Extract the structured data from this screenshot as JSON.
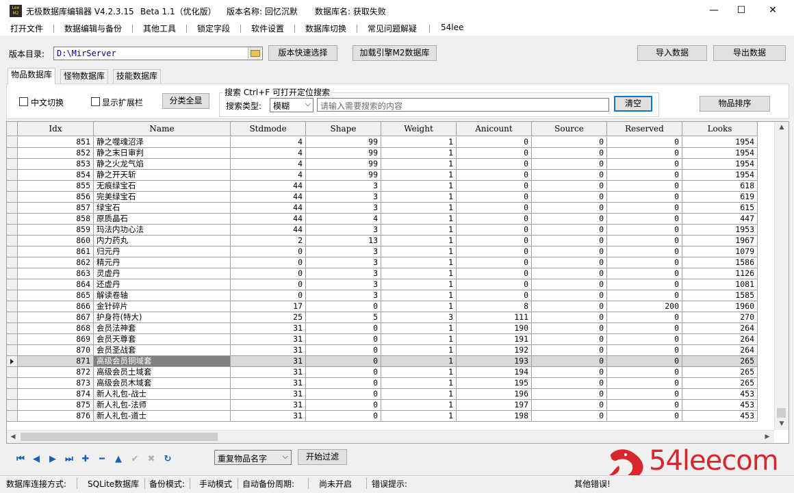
{
  "window": {
    "app_name": "无极数据库编辑器 V4.2.3.15",
    "build": "Beta 1.1（优化版）",
    "version_label": "版本名称: 回忆沉默",
    "db_label": "数据库名: 获取失败",
    "icon_text": "Lee M2",
    "minimize": "—",
    "maximize": "☐",
    "close": "✕"
  },
  "menu": [
    "打开文件",
    "数据编辑与备份",
    "其他工具",
    "锁定字段",
    "软件设置",
    "数据库切换",
    "常见问题解疑",
    "54lee"
  ],
  "toolbar": {
    "dir_label": "版本目录:",
    "dir_value": "D:\\MirServer",
    "quick_select": "版本快速选择",
    "load_engine": "加载引擎M2数据库",
    "import": "导入数据",
    "export": "导出数据"
  },
  "tabs": [
    "物品数据库",
    "怪物数据库",
    "技能数据库"
  ],
  "filters": {
    "chinese_toggle": "中文切换",
    "show_extended": "显示扩展栏",
    "show_all": "分类全显",
    "search_group_title": "搜索   Ctrl+F 可打开定位搜索",
    "search_type_label": "搜索类型:",
    "search_type_value": "模糊",
    "search_placeholder": "请输入需要搜索的内容",
    "clear": "清空",
    "sort": "物品排序"
  },
  "table": {
    "columns": [
      "Idx",
      "Name",
      "Stdmode",
      "Shape",
      "Weight",
      "Anicount",
      "Source",
      "Reserved",
      "Looks"
    ],
    "rows": [
      [
        "851",
        "静之噬魂沼泽",
        "4",
        "99",
        "1",
        "0",
        "0",
        "0",
        "1954"
      ],
      [
        "852",
        "静之末日审判",
        "4",
        "99",
        "1",
        "0",
        "0",
        "0",
        "1954"
      ],
      [
        "853",
        "静之火龙气焰",
        "4",
        "99",
        "1",
        "0",
        "0",
        "0",
        "1954"
      ],
      [
        "854",
        "静之开天斩",
        "4",
        "99",
        "1",
        "0",
        "0",
        "0",
        "1954"
      ],
      [
        "855",
        "无痕绿宝石",
        "44",
        "3",
        "1",
        "0",
        "0",
        "0",
        "618"
      ],
      [
        "856",
        "完美绿宝石",
        "44",
        "3",
        "1",
        "0",
        "0",
        "0",
        "619"
      ],
      [
        "857",
        "绿宝石",
        "44",
        "3",
        "1",
        "0",
        "0",
        "0",
        "615"
      ],
      [
        "858",
        "原质晶石",
        "44",
        "4",
        "1",
        "0",
        "0",
        "0",
        "447"
      ],
      [
        "859",
        "玛法内功心法",
        "44",
        "3",
        "1",
        "0",
        "0",
        "0",
        "1953"
      ],
      [
        "860",
        "内力药丸",
        "2",
        "13",
        "1",
        "0",
        "0",
        "0",
        "1967"
      ],
      [
        "861",
        "归元丹",
        "0",
        "3",
        "1",
        "0",
        "0",
        "0",
        "1079"
      ],
      [
        "862",
        "精元丹",
        "0",
        "3",
        "1",
        "0",
        "0",
        "0",
        "1586"
      ],
      [
        "863",
        "灵虚丹",
        "0",
        "3",
        "1",
        "0",
        "0",
        "0",
        "1126"
      ],
      [
        "864",
        "还虚丹",
        "0",
        "3",
        "1",
        "0",
        "0",
        "0",
        "1081"
      ],
      [
        "865",
        "解读卷轴",
        "0",
        "3",
        "1",
        "0",
        "0",
        "0",
        "1585"
      ],
      [
        "866",
        "金针碎片",
        "17",
        "0",
        "1",
        "8",
        "0",
        "200",
        "1960"
      ],
      [
        "867",
        "护身符(特大)",
        "25",
        "5",
        "3",
        "111",
        "0",
        "0",
        "270"
      ],
      [
        "868",
        "会员法神套",
        "31",
        "0",
        "1",
        "190",
        "0",
        "0",
        "264"
      ],
      [
        "869",
        "会员天尊套",
        "31",
        "0",
        "1",
        "191",
        "0",
        "0",
        "264"
      ],
      [
        "870",
        "会员圣战套",
        "31",
        "0",
        "1",
        "192",
        "0",
        "0",
        "264"
      ],
      [
        "871",
        "高级会员铜域套",
        "31",
        "0",
        "1",
        "193",
        "0",
        "0",
        "265"
      ],
      [
        "872",
        "高级会员土域套",
        "31",
        "0",
        "1",
        "194",
        "0",
        "0",
        "265"
      ],
      [
        "873",
        "高级会员木域套",
        "31",
        "0",
        "1",
        "195",
        "0",
        "0",
        "265"
      ],
      [
        "874",
        "新人礼包-战士",
        "31",
        "0",
        "1",
        "196",
        "0",
        "0",
        "453"
      ],
      [
        "875",
        "新人礼包-法师",
        "31",
        "0",
        "1",
        "197",
        "0",
        "0",
        "453"
      ],
      [
        "876",
        "新人礼包-道士",
        "31",
        "0",
        "1",
        "198",
        "0",
        "0",
        "453"
      ]
    ],
    "selected_idx": "871"
  },
  "nav": {
    "icons": [
      "first-icon",
      "prior-icon",
      "next-icon",
      "last-icon",
      "insert-icon",
      "delete-icon",
      "edit-icon",
      "post-icon",
      "cancel-icon",
      "refresh-icon"
    ],
    "filter_value": "重复物品名字",
    "start_filter": "开始过滤"
  },
  "watermark": "54leecom",
  "status": {
    "conn_label": "数据库连接方式:",
    "conn_value": "SQLite数据库",
    "backup_label": "备份模式:",
    "backup_value": "手动模式",
    "auto_label": "自动备份周期:",
    "auto_value": "尚未开启",
    "error_label": "错误提示:",
    "other_error": "其他错误!"
  },
  "colors": {
    "accent": "#0078d7",
    "nav_icon": "#1a5fb4",
    "watermark": "#d8262d",
    "selection": "#808080"
  }
}
